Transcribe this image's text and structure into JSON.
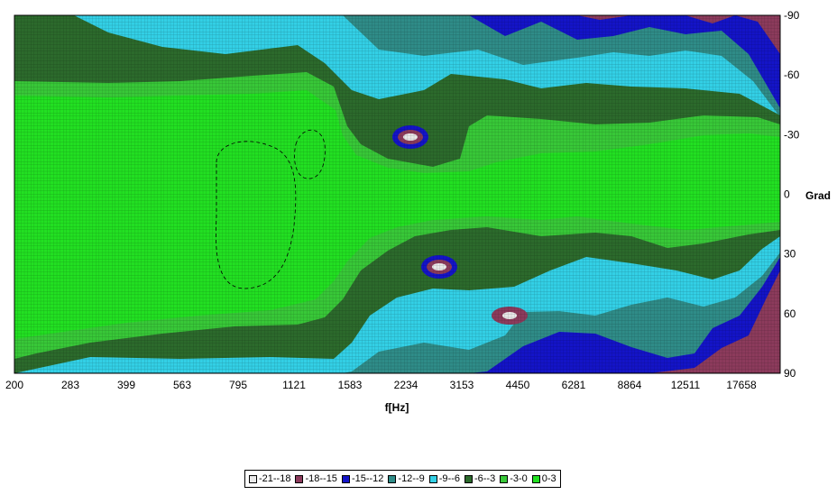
{
  "chart_data": {
    "type": "heatmap",
    "title": "",
    "xlabel": "f[Hz]",
    "ylabel": "Grad",
    "x_ticks": [
      "200",
      "283",
      "399",
      "563",
      "795",
      "1121",
      "1583",
      "2234",
      "3153",
      "4450",
      "6281",
      "8864",
      "12511",
      "17658"
    ],
    "y_ticks": [
      "-90",
      "-60",
      "-30",
      "0",
      "30",
      "60",
      "90"
    ],
    "ylim": [
      -90,
      90
    ],
    "x_scale": "log",
    "grid": true,
    "legend_position": "bottom",
    "levels": [
      {
        "label": "-21--18",
        "color": "#e9e9e9"
      },
      {
        "label": "-18--15",
        "color": "#8c3b5c"
      },
      {
        "label": "-15--12",
        "color": "#1414c8"
      },
      {
        "label": "-12--9",
        "color": "#2f8c88"
      },
      {
        "label": "-9--6",
        "color": "#33d0e6"
      },
      {
        "label": "-6--3",
        "color": "#2c6a2c"
      },
      {
        "label": "-3-0",
        "color": "#38c838"
      },
      {
        "label": "0-3",
        "color": "#22e022"
      }
    ]
  }
}
